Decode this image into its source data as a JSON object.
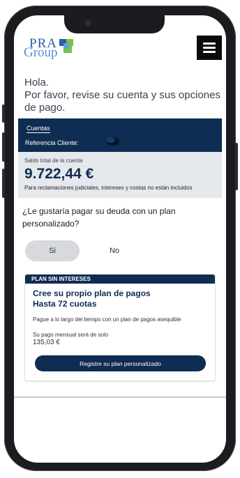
{
  "brand": {
    "logo_line1": "PRA",
    "logo_line2": "Group"
  },
  "greeting": {
    "hello": "Hola.",
    "message": "Por favor, revise su cuenta y sus opciones de pago."
  },
  "account": {
    "section_label": "Cuentas",
    "reference_label": "Referencia Cliente:"
  },
  "balance": {
    "label": "Saldo total de la cuenta",
    "amount": "9.722,44 €",
    "note": "Para reclamaciones judiciales, intereses y costas no están incluidos"
  },
  "question": {
    "text": "¿Le gustaría pagar su deuda con un plan personalizado?"
  },
  "options": {
    "yes": "Si",
    "no": "No",
    "selected": "Si"
  },
  "plan": {
    "banner": "PLAN SIN INTERESES",
    "title_line1": "Cree su propio plan de pagos",
    "title_line2": "Hasta 72 cuotas",
    "description": "Pague a lo largo del tiempo con un plan de pagos asequible",
    "monthly_label": "Su pago mensual será de solo",
    "monthly_amount": "135,03 €",
    "cta": "Registre su plan personalizado"
  },
  "colors": {
    "navy": "#0f2c52",
    "logo_blue": "#2b5ea7",
    "logo_green": "#7cc242",
    "grey_panel": "#e5e8ec"
  },
  "icons": {
    "menu": "hamburger-menu-icon"
  }
}
